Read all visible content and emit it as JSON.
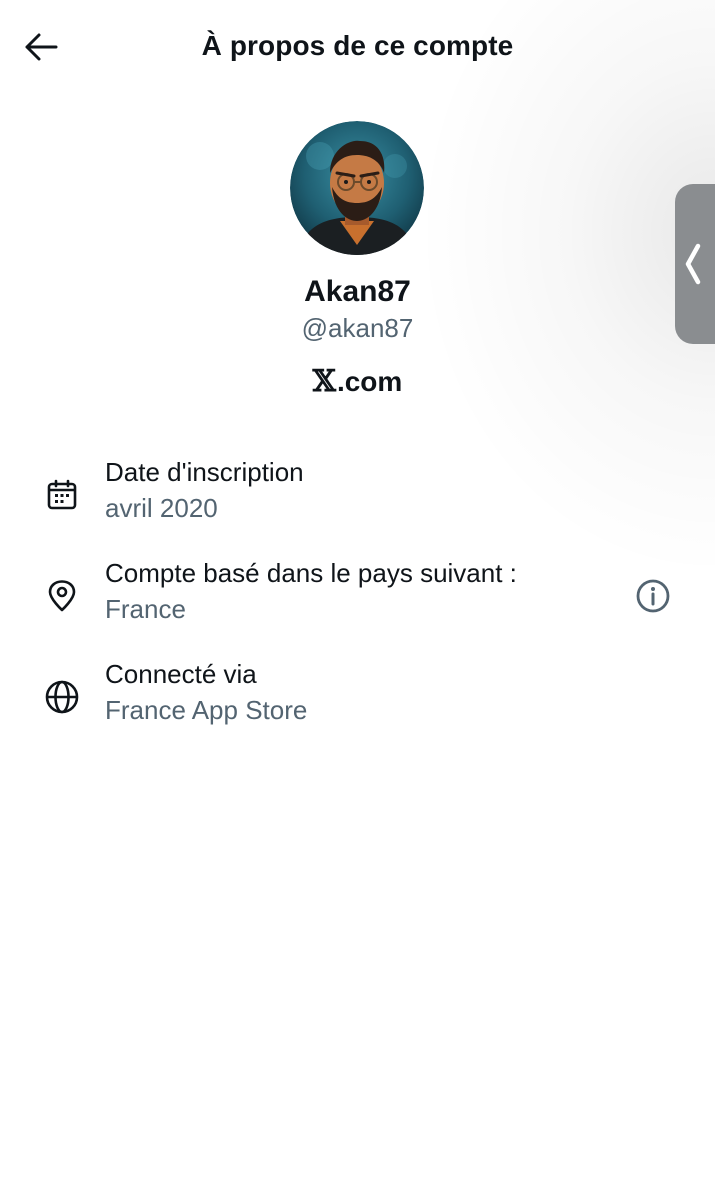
{
  "header": {
    "title": "À propos de ce compte"
  },
  "profile": {
    "display_name": "Akan87",
    "handle": "@akan87",
    "via_domain_suffix": ".com"
  },
  "info_rows": [
    {
      "icon": "calendar-icon",
      "label": "Date d'inscription",
      "value": "avril 2020"
    },
    {
      "icon": "location-pin-icon",
      "label": "Compte basé dans le pays suivant :",
      "value": "France"
    },
    {
      "icon": "globe-icon",
      "label": "Connecté via",
      "value": "France App Store"
    }
  ],
  "colors": {
    "primary_text": "#0f1419",
    "secondary_text": "#536471",
    "edge_tab": "#8a8d90"
  }
}
